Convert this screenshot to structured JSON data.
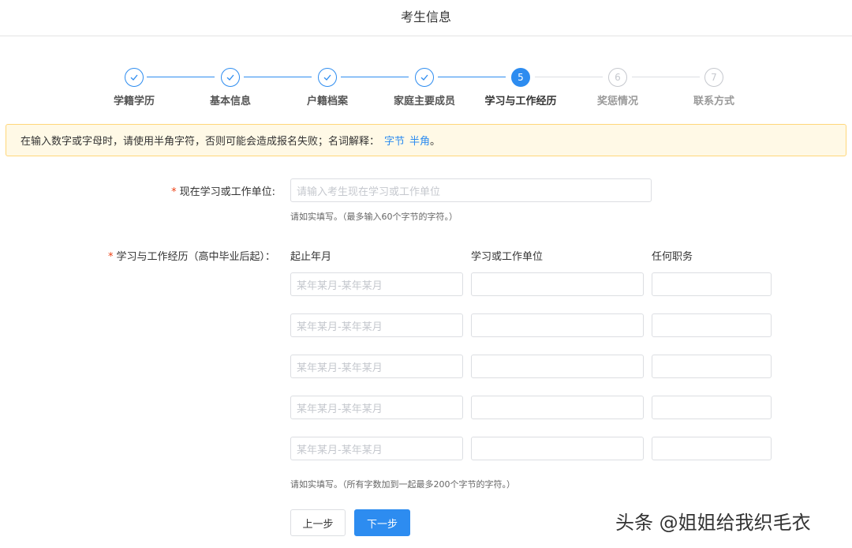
{
  "header": {
    "title": "考生信息"
  },
  "steps": [
    {
      "label": "学籍学历",
      "state": "done",
      "number": "1"
    },
    {
      "label": "基本信息",
      "state": "done",
      "number": "2"
    },
    {
      "label": "户籍档案",
      "state": "done",
      "number": "3"
    },
    {
      "label": "家庭主要成员",
      "state": "done",
      "number": "4"
    },
    {
      "label": "学习与工作经历",
      "state": "active",
      "number": "5"
    },
    {
      "label": "奖惩情况",
      "state": "pending",
      "number": "6"
    },
    {
      "label": "联系方式",
      "state": "pending",
      "number": "7"
    }
  ],
  "notice": {
    "text": "在输入数字或字母时，请使用半角字符，否则可能会造成报名失败；名词解释：",
    "link_bytes": "字节",
    "link_halfwidth": "半角",
    "end": "。"
  },
  "current_unit": {
    "required_mark": "*",
    "label": "现在学习或工作单位:",
    "placeholder": "请输入考生现在学习或工作单位",
    "hint": "请如实填写。（最多输入60个字节的字符。）"
  },
  "history": {
    "required_mark": "*",
    "label": "学习与工作经历（高中毕业后起）：",
    "columns": [
      "起止年月",
      "学习或工作单位",
      "任何职务"
    ],
    "rows": [
      {
        "period_placeholder": "某年某月-某年某月",
        "unit": "",
        "position": ""
      },
      {
        "period_placeholder": "某年某月-某年某月",
        "unit": "",
        "position": ""
      },
      {
        "period_placeholder": "某年某月-某年某月",
        "unit": "",
        "position": ""
      },
      {
        "period_placeholder": "某年某月-某年某月",
        "unit": "",
        "position": ""
      },
      {
        "period_placeholder": "某年某月-某年某月",
        "unit": "",
        "position": ""
      }
    ],
    "hint": "请如实填写。（所有字数加到一起最多200个字节的字符。）"
  },
  "buttons": {
    "prev": "上一步",
    "next": "下一步"
  },
  "watermark": "头条 @姐姐给我织毛衣",
  "colors": {
    "primary": "#2d8cf0",
    "required": "#ed4014",
    "notice_bg": "#fff9e6",
    "notice_border": "#ffd77a"
  }
}
